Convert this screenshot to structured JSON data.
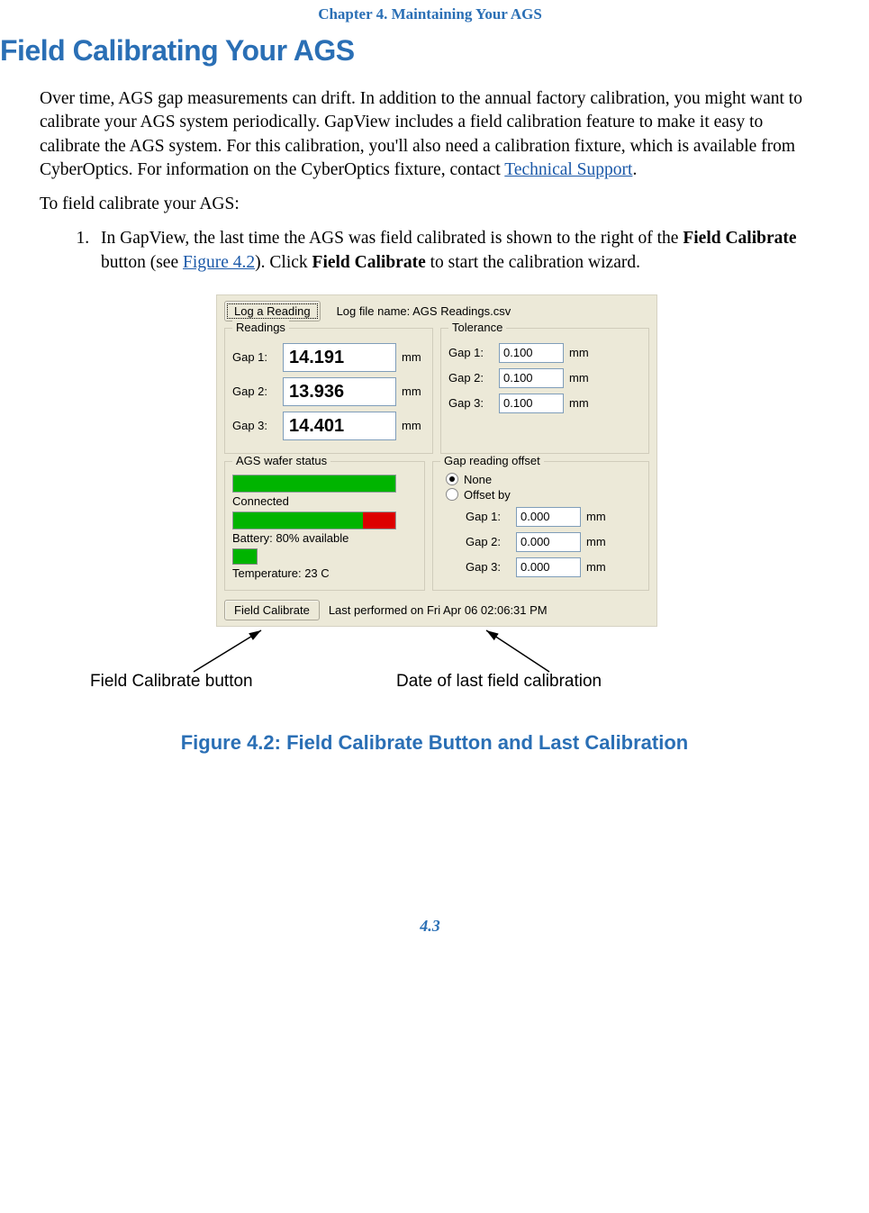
{
  "header": {
    "chapter": "Chapter 4. Maintaining Your AGS"
  },
  "section": {
    "title": "Field Calibrating Your AGS",
    "para_1a": "Over time, AGS gap measurements can drift. In addition to the annual factory calibration, you might want to calibrate your AGS system periodically. GapView includes a field calibration feature to make it easy to calibrate the AGS system. For this calibration, you'll also need a calibration fixture, which is available from CyberOptics. For information on the CyberOptics fixture, contact ",
    "tech_support_link": "Technical Support",
    "para_1b": ".",
    "instruction": "To field calibrate your AGS:",
    "step_1a": "In GapView, the last time the AGS was field calibrated is shown to the right of the ",
    "step_1_bold1": "Field Calibrate",
    "step_1b": " button (see ",
    "figure_link": "Figure 4.2",
    "step_1c": "). Click ",
    "step_1_bold2": "Field Calibrate",
    "step_1d": " to start the calibration wizard."
  },
  "gapview": {
    "log_button": "Log a Reading",
    "log_file_label": "Log file name:  AGS Readings.csv",
    "readings_legend": "Readings",
    "tolerance_legend": "Tolerance",
    "unit": "mm",
    "gaps": [
      {
        "label": "Gap 1:",
        "reading": "14.191",
        "tolerance": "0.100"
      },
      {
        "label": "Gap 2:",
        "reading": "13.936",
        "tolerance": "0.100"
      },
      {
        "label": "Gap 3:",
        "reading": "14.401",
        "tolerance": "0.100"
      }
    ],
    "status_legend": "AGS wafer status",
    "connected_label": "Connected",
    "battery_label": "Battery: 80% available",
    "temperature_label": "Temperature: 23 C",
    "offset_legend": "Gap reading offset",
    "offset_none": "None",
    "offset_by": "Offset by",
    "offsets": [
      {
        "label": "Gap 1:",
        "value": "0.000"
      },
      {
        "label": "Gap 2:",
        "value": "0.000"
      },
      {
        "label": "Gap 3:",
        "value": "0.000"
      }
    ],
    "field_cal_button": "Field Calibrate",
    "last_performed": "Last performed on Fri Apr 06 02:06:31 PM"
  },
  "callouts": {
    "left": "Field Calibrate button",
    "right": "Date of last field calibration"
  },
  "figure_caption": "Figure 4.2: Field Calibrate Button and Last Calibration",
  "page_number": "4.3"
}
